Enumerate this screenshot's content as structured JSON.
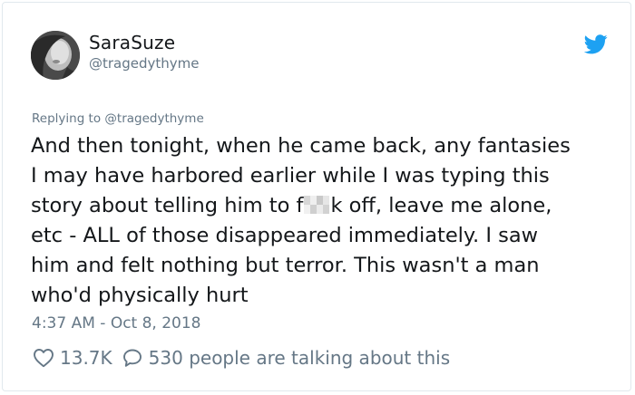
{
  "user": {
    "display_name": "SaraSuze",
    "handle": "@tragedythyme"
  },
  "tweet": {
    "replying_to": "Replying to @tragedythyme",
    "lines": [
      "And then tonight, when he came back, any fantasies",
      "I may have harbored earlier while I was typing this"
    ],
    "line3_before": "story about telling him to f",
    "line3_after": "k off, leave me alone,",
    "lines_end": [
      "etc - ALL of those disappeared immediately. I saw",
      "him and felt nothing but terror. This wasn't a man",
      "who'd physically hurt"
    ],
    "timestamp": "4:37 AM - Oct 8, 2018"
  },
  "stats": {
    "likes": "13.7K",
    "talking": "530 people are talking about this"
  },
  "icons": {
    "brand": "twitter-bird-icon",
    "like": "heart-icon",
    "reply": "speech-bubble-icon"
  },
  "colors": {
    "brand": "#1da1f2",
    "muted": "#657786",
    "text": "#14171a"
  }
}
